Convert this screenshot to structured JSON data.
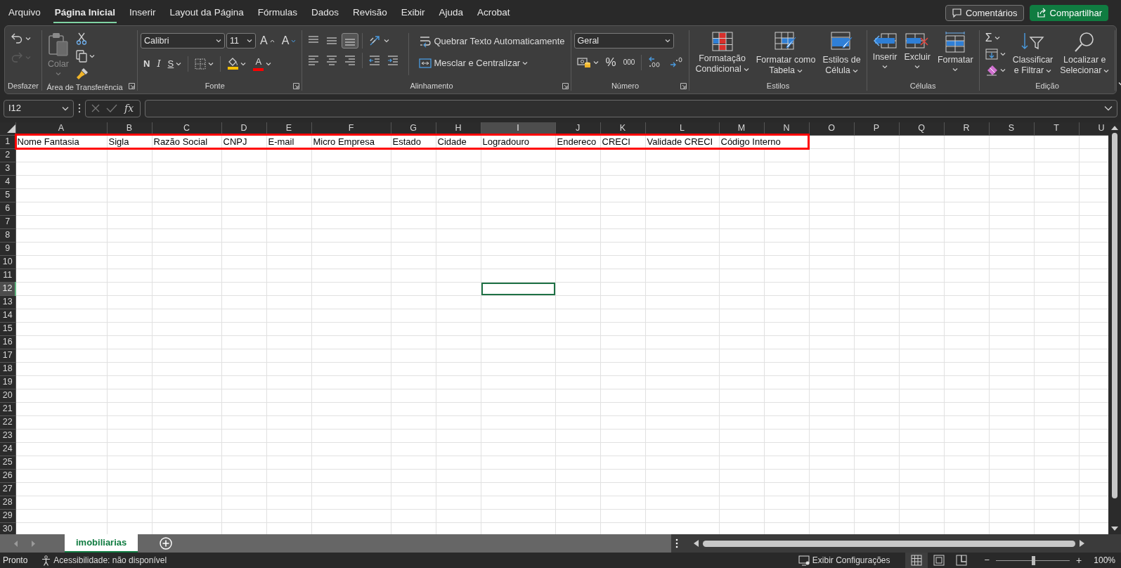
{
  "menu_tabs": [
    {
      "label": "Arquivo",
      "selected": false
    },
    {
      "label": "Página Inicial",
      "selected": true
    },
    {
      "label": "Inserir",
      "selected": false
    },
    {
      "label": "Layout da Página",
      "selected": false
    },
    {
      "label": "Fórmulas",
      "selected": false
    },
    {
      "label": "Dados",
      "selected": false
    },
    {
      "label": "Revisão",
      "selected": false
    },
    {
      "label": "Exibir",
      "selected": false
    },
    {
      "label": "Ajuda",
      "selected": false
    },
    {
      "label": "Acrobat",
      "selected": false
    }
  ],
  "header_buttons": [
    {
      "kind": "comments",
      "label": "Comentários"
    },
    {
      "kind": "share",
      "label": "Compartilhar"
    }
  ],
  "ribbon": {
    "groups": [
      {
        "label": "Desfazer",
        "items": [
          {
            "kind": "undo",
            "disabled": false
          },
          {
            "kind": "redo",
            "disabled": true
          }
        ]
      },
      {
        "label": "Área de Transferência",
        "launcher": true,
        "items": [
          {
            "kind": "paste",
            "label": [
              "Colar"
            ],
            "disabled": true
          },
          {
            "kind": "cut",
            "disabled": false
          },
          {
            "kind": "copy",
            "disabled": false
          },
          {
            "kind": "format-painter",
            "disabled": false
          }
        ]
      },
      {
        "label": "Fonte",
        "launcher": true,
        "items": [
          {
            "kind": "font-name",
            "value": "Calibri"
          },
          {
            "kind": "font-size",
            "value": "11"
          },
          {
            "kind": "grow",
            "glyph": "A"
          },
          {
            "kind": "shrink",
            "glyph": "A"
          },
          {
            "kind": "bold",
            "glyph": "N"
          },
          {
            "kind": "italic",
            "glyph": "I"
          },
          {
            "kind": "underline",
            "glyph": "S"
          },
          {
            "kind": "borders"
          },
          {
            "kind": "fill-color",
            "color": "#ffc000"
          },
          {
            "kind": "font-color",
            "glyph": "A",
            "color": "#ff0000"
          }
        ]
      },
      {
        "label": "Alinhamento",
        "launcher": true,
        "items": [
          {
            "kind": "align-top",
            "selected": false
          },
          {
            "kind": "align-middle",
            "selected": false
          },
          {
            "kind": "align-bottom",
            "selected": true
          },
          {
            "kind": "orientation"
          },
          {
            "kind": "wrap",
            "label": [
              "Quebrar Texto Automaticamente"
            ]
          },
          {
            "kind": "align-left",
            "selected": false
          },
          {
            "kind": "align-center",
            "selected": false
          },
          {
            "kind": "align-right",
            "selected": false
          },
          {
            "kind": "indent-decrease"
          },
          {
            "kind": "indent-increase"
          },
          {
            "kind": "merge",
            "label": [
              "Mesclar e Centralizar"
            ]
          }
        ]
      },
      {
        "label": "Número",
        "launcher": true,
        "items": [
          {
            "kind": "number-format",
            "value": "Geral"
          },
          {
            "kind": "accounting"
          },
          {
            "kind": "percent",
            "glyph": "%"
          },
          {
            "kind": "comma",
            "glyph": "000"
          },
          {
            "kind": "decimal-increase"
          },
          {
            "kind": "decimal-decrease"
          }
        ]
      },
      {
        "label": "Estilos",
        "items": [
          {
            "kind": "conditional",
            "label": [
              "Formatação",
              "Condicional"
            ]
          },
          {
            "kind": "table",
            "label": [
              "Formatar como",
              "Tabela"
            ]
          },
          {
            "kind": "cell-styles",
            "label": [
              "Estilos de",
              "Célula"
            ]
          }
        ]
      },
      {
        "label": "Células",
        "items": [
          {
            "kind": "insert",
            "label": [
              "Inserir"
            ]
          },
          {
            "kind": "delete",
            "label": [
              "Excluir"
            ]
          },
          {
            "kind": "format",
            "label": [
              "Formatar"
            ]
          }
        ]
      },
      {
        "label": "Edição",
        "items": [
          {
            "kind": "sum",
            "glyph": "Σ"
          },
          {
            "kind": "fill"
          },
          {
            "kind": "clear"
          },
          {
            "kind": "sort",
            "label": [
              "Classificar",
              "e Filtrar"
            ]
          },
          {
            "kind": "find",
            "label": [
              "Localizar e",
              "Selecionar"
            ]
          }
        ]
      }
    ]
  },
  "formula_bar": {
    "name_box": "I12",
    "function_glyph": "fx"
  },
  "sheet": {
    "columns": [
      {
        "label": "A",
        "selected": false
      },
      {
        "label": "B",
        "selected": false
      },
      {
        "label": "C",
        "selected": false
      },
      {
        "label": "D",
        "selected": false
      },
      {
        "label": "E",
        "selected": false
      },
      {
        "label": "F",
        "selected": false
      },
      {
        "label": "G",
        "selected": false
      },
      {
        "label": "H",
        "selected": false
      },
      {
        "label": "I",
        "selected": true
      },
      {
        "label": "J",
        "selected": false
      },
      {
        "label": "K",
        "selected": false
      },
      {
        "label": "L",
        "selected": false
      },
      {
        "label": "M",
        "selected": false
      },
      {
        "label": "N",
        "selected": false
      },
      {
        "label": "O",
        "selected": false
      },
      {
        "label": "P",
        "selected": false
      },
      {
        "label": "Q",
        "selected": false
      },
      {
        "label": "R",
        "selected": false
      },
      {
        "label": "S",
        "selected": false
      },
      {
        "label": "T",
        "selected": false
      },
      {
        "label": "U",
        "selected": false
      }
    ],
    "rows": [
      {
        "number": "1",
        "selected": false,
        "outlined": true,
        "cells": [
          "Nome Fantasia",
          "Sigla",
          "Razão Social",
          "CNPJ",
          "E-mail",
          "Micro Empresa",
          "Estado",
          "Cidade",
          "Logradouro",
          "Endereco",
          "CRECI",
          "Validade CRECI",
          "Código Interno"
        ]
      },
      {
        "number": "2",
        "selected": false
      },
      {
        "number": "3",
        "selected": false
      },
      {
        "number": "4",
        "selected": false
      },
      {
        "number": "5",
        "selected": false
      },
      {
        "number": "6",
        "selected": false
      },
      {
        "number": "7",
        "selected": false
      },
      {
        "number": "8",
        "selected": false
      },
      {
        "number": "9",
        "selected": false
      },
      {
        "number": "10",
        "selected": false
      },
      {
        "number": "11",
        "selected": false
      },
      {
        "number": "12",
        "selected": true
      },
      {
        "number": "13",
        "selected": false
      },
      {
        "number": "14",
        "selected": false
      },
      {
        "number": "15",
        "selected": false
      },
      {
        "number": "16",
        "selected": false
      },
      {
        "number": "17",
        "selected": false
      },
      {
        "number": "18",
        "selected": false
      },
      {
        "number": "19",
        "selected": false
      },
      {
        "number": "20",
        "selected": false
      },
      {
        "number": "21",
        "selected": false
      },
      {
        "number": "22",
        "selected": false
      },
      {
        "number": "23",
        "selected": false
      },
      {
        "number": "24",
        "selected": false
      },
      {
        "number": "25",
        "selected": false
      },
      {
        "number": "26",
        "selected": false
      },
      {
        "number": "27",
        "selected": false
      },
      {
        "number": "28",
        "selected": false
      },
      {
        "number": "29",
        "selected": false
      },
      {
        "number": "30",
        "selected": false
      }
    ]
  },
  "sheet_tabs": [
    {
      "label": "imobiliarias",
      "selected": true
    }
  ],
  "status_bar": {
    "ready": "Pronto",
    "accessibility": "Acessibilidade: não disponível",
    "display_settings": "Exibir Configurações",
    "views": [
      {
        "kind": "normal",
        "selected": true
      },
      {
        "kind": "page-layout",
        "selected": false
      },
      {
        "kind": "page-break",
        "selected": false
      }
    ],
    "zoom_out": "−",
    "zoom": {
      "level": 0.5
    },
    "zoom_in": "+",
    "zoom_label": "100%"
  }
}
